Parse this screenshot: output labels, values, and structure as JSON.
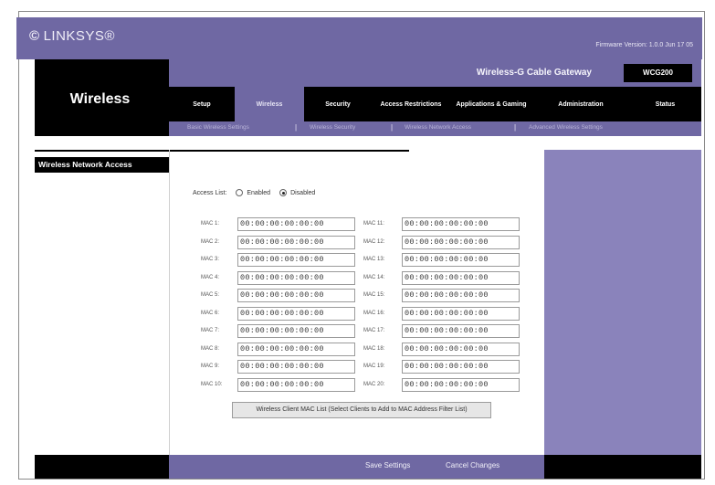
{
  "header": {
    "logo_mark": "©",
    "logo_text": "LINKSYS®",
    "firmware": "Firmware Version: 1.0.0 Jun 17 05"
  },
  "section_title": "Wireless",
  "product": {
    "name": "Wireless-G Cable Gateway",
    "model": "WCG200"
  },
  "tabs": [
    {
      "label": "Setup"
    },
    {
      "label": "Wireless"
    },
    {
      "label": "Security"
    },
    {
      "label": "Access Restrictions"
    },
    {
      "label": "Applications & Gaming"
    },
    {
      "label": "Administration"
    },
    {
      "label": "Status"
    }
  ],
  "subtabs": [
    "Basic Wireless Settings",
    "Wireless Security",
    "Wireless Network Access",
    "Advanced Wireless Settings"
  ],
  "sidebar_heading": "Wireless Network Access",
  "access_list": {
    "label": "Access List:",
    "option_enabled": "Enabled",
    "option_disabled": "Disabled"
  },
  "mac_left": [
    {
      "label": "MAC 1:",
      "value": "00:00:00:00:00:00"
    },
    {
      "label": "MAC 2:",
      "value": "00:00:00:00:00:00"
    },
    {
      "label": "MAC 3:",
      "value": "00:00:00:00:00:00"
    },
    {
      "label": "MAC 4:",
      "value": "00:00:00:00:00:00"
    },
    {
      "label": "MAC 5:",
      "value": "00:00:00:00:00:00"
    },
    {
      "label": "MAC 6:",
      "value": "00:00:00:00:00:00"
    },
    {
      "label": "MAC 7:",
      "value": "00:00:00:00:00:00"
    },
    {
      "label": "MAC 8:",
      "value": "00:00:00:00:00:00"
    },
    {
      "label": "MAC 9:",
      "value": "00:00:00:00:00:00"
    },
    {
      "label": "MAC 10:",
      "value": "00:00:00:00:00:00"
    }
  ],
  "mac_right": [
    {
      "label": "MAC 11:",
      "value": "00:00:00:00:00:00"
    },
    {
      "label": "MAC 12:",
      "value": "00:00:00:00:00:00"
    },
    {
      "label": "MAC 13:",
      "value": "00:00:00:00:00:00"
    },
    {
      "label": "MAC 14:",
      "value": "00:00:00:00:00:00"
    },
    {
      "label": "MAC 15:",
      "value": "00:00:00:00:00:00"
    },
    {
      "label": "MAC 16:",
      "value": "00:00:00:00:00:00"
    },
    {
      "label": "MAC 17:",
      "value": "00:00:00:00:00:00"
    },
    {
      "label": "MAC 18:",
      "value": "00:00:00:00:00:00"
    },
    {
      "label": "MAC 19:",
      "value": "00:00:00:00:00:00"
    },
    {
      "label": "MAC 20:",
      "value": "00:00:00:00:00:00"
    }
  ],
  "wireless_client_button": "Wireless Client MAC List (Select Clients to Add to MAC Address Filter List)",
  "footer": {
    "save": "Save Settings",
    "cancel": "Cancel Changes"
  }
}
